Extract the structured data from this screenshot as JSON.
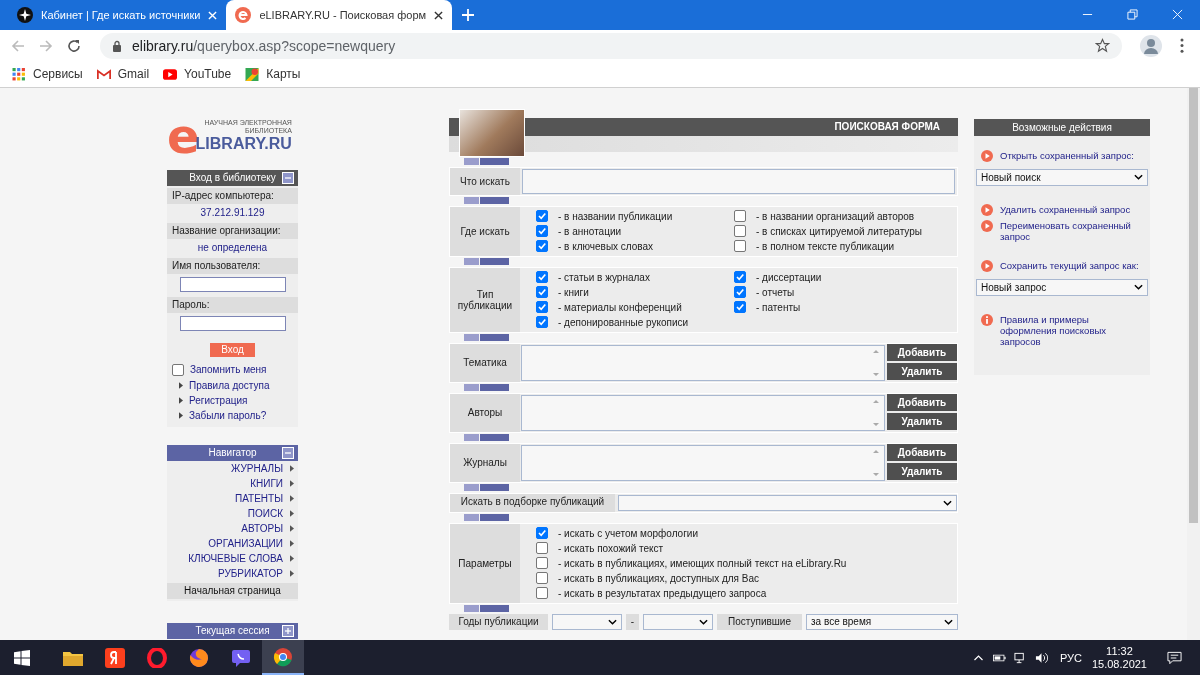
{
  "browser": {
    "tabs": [
      {
        "kind": "cabinet",
        "title": "Кабинет | Где искать источники",
        "selected": false
      },
      {
        "kind": "elibrary",
        "title": "eLIBRARY.RU - Поисковая форм",
        "selected": true
      }
    ],
    "address": {
      "host": "elibrary.ru",
      "path": "/querybox.asp?scope=newquery"
    },
    "bookmarks": [
      {
        "kind": "apps",
        "label": "Сервисы"
      },
      {
        "kind": "gmail",
        "label": "Gmail"
      },
      {
        "kind": "youtube",
        "label": "YouTube"
      },
      {
        "kind": "maps",
        "label": "Карты"
      }
    ]
  },
  "logo": {
    "tagline": [
      "НАУЧНАЯ ЭЛЕКТРОННАЯ",
      "БИБЛИОТЕКА"
    ],
    "letter": "e",
    "name": "LIBRARY.RU"
  },
  "login_panel": {
    "title": "Вход в библиотеку",
    "expanded": true,
    "fields": [
      {
        "kind": "value",
        "label": "IP-адрес компьютера:",
        "value": "37.212.91.129"
      },
      {
        "kind": "value",
        "label": "Название организации:",
        "value": "не определена"
      },
      {
        "kind": "input",
        "label": "Имя пользователя:"
      },
      {
        "kind": "input",
        "label": "Пароль:"
      }
    ],
    "button": "Вход",
    "remember": {
      "label": "Запомнить меня",
      "checked": false
    },
    "links": [
      "Правила доступа",
      "Регистрация",
      "Забыли пароль?"
    ]
  },
  "navigator": {
    "title": "Навигатор",
    "expanded": true,
    "items": [
      "ЖУРНАЛЫ",
      "КНИГИ",
      "ПАТЕНТЫ",
      "ПОИСК",
      "АВТОРЫ",
      "ОРГАНИЗАЦИИ",
      "КЛЮЧЕВЫЕ СЛОВА",
      "РУБРИКАТОР"
    ],
    "home": "Начальная страница"
  },
  "session_panel": {
    "title": "Текущая сессия",
    "expanded": false
  },
  "search_form": {
    "title": "ПОИСКОВАЯ ФОРМА",
    "rows": [
      {
        "kind": "text",
        "label": "Что искать"
      },
      {
        "kind": "checkgrid",
        "label": "Где искать",
        "options": [
          {
            "label": "- в названии публикации",
            "checked": true
          },
          {
            "label": "- в названии организаций авторов",
            "checked": false
          },
          {
            "label": "- в аннотации",
            "checked": true
          },
          {
            "label": "- в списках цитируемой литературы",
            "checked": false
          },
          {
            "label": "- в ключевых словах",
            "checked": true
          },
          {
            "label": "- в полном тексте публикации",
            "checked": false
          }
        ]
      },
      {
        "kind": "checkgrid",
        "label": "Тип публикации",
        "options": [
          {
            "label": "- статьи в журналах",
            "checked": true
          },
          {
            "label": "- диссертации",
            "checked": true
          },
          {
            "label": "- книги",
            "checked": true
          },
          {
            "label": "- отчеты",
            "checked": true
          },
          {
            "label": "- материалы конференций",
            "checked": true
          },
          {
            "label": "- патенты",
            "checked": true
          },
          {
            "label": "- депонированные рукописи",
            "checked": true
          }
        ]
      },
      {
        "kind": "list",
        "label": "Тематика",
        "buttons": [
          "Добавить",
          "Удалить"
        ]
      },
      {
        "kind": "list",
        "label": "Авторы",
        "buttons": [
          "Добавить",
          "Удалить"
        ]
      },
      {
        "kind": "list",
        "label": "Журналы",
        "buttons": [
          "Добавить",
          "Удалить"
        ]
      },
      {
        "kind": "select",
        "label": "Искать в подборке публикаций"
      },
      {
        "kind": "checklist",
        "label": "Параметры",
        "options": [
          {
            "label": "- искать с учетом морфологии",
            "checked": true
          },
          {
            "label": "- искать похожий текст",
            "checked": false
          },
          {
            "label": "- искать в публикациях, имеющих полный текст на eLibrary.Ru",
            "checked": false
          },
          {
            "label": "- искать в публикациях, доступных для Вас",
            "checked": false
          },
          {
            "label": "- искать в результатах предыдущего запроса",
            "checked": false
          }
        ]
      },
      {
        "kind": "years",
        "label": "Годы публикации",
        "separator": "-",
        "received_label": "Поступившие",
        "received_value": "за все время"
      }
    ]
  },
  "actions_panel": {
    "title": "Возможные действия",
    "groups": [
      [
        {
          "kind": "link",
          "label": "Открыть сохраненный запрос:"
        },
        {
          "kind": "select",
          "value": "Новый поиск"
        }
      ],
      [
        {
          "kind": "link",
          "label": "Удалить сохраненный запрос"
        },
        {
          "kind": "link",
          "label": "Переименовать сохраненный запрос"
        }
      ],
      [
        {
          "kind": "link",
          "label": "Сохранить текущий запрос как:"
        },
        {
          "kind": "select",
          "value": "Новый запрос"
        }
      ],
      [
        {
          "kind": "info",
          "label": "Правила и примеры оформления поисковых запросов"
        }
      ]
    ]
  },
  "taskbar": {
    "apps": [
      {
        "kind": "folder",
        "active": false
      },
      {
        "kind": "tile",
        "active": false
      },
      {
        "kind": "ring",
        "active": false
      },
      {
        "kind": "globe",
        "active": false
      },
      {
        "kind": "chat",
        "active": false
      },
      {
        "kind": "wheel",
        "active": true
      }
    ],
    "tray": {
      "language": "РУС",
      "time": "11:32",
      "date": "15.08.2021"
    }
  }
}
